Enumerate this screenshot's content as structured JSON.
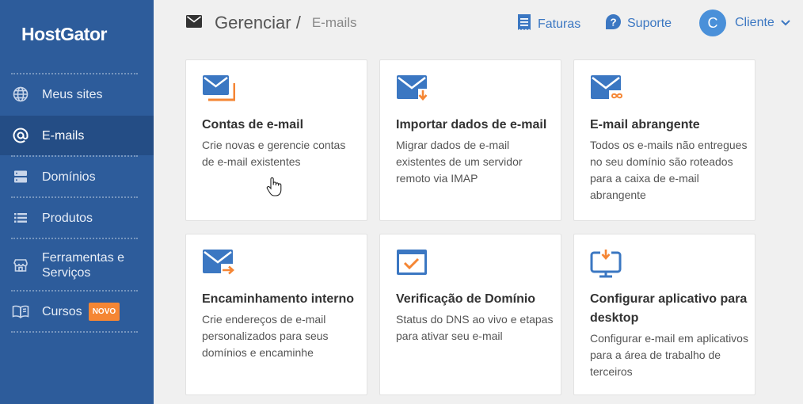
{
  "brand": {
    "logo": "HostGator"
  },
  "sidebar": {
    "items": [
      {
        "label": "Meus sites",
        "icon": "globe-icon"
      },
      {
        "label": "E-mails",
        "icon": "at-icon",
        "active": true
      },
      {
        "label": "Domínios",
        "icon": "server-icon"
      },
      {
        "label": "Produtos",
        "icon": "list-icon"
      },
      {
        "label": "Ferramentas e Serviços",
        "icon": "store-icon"
      },
      {
        "label": "Cursos",
        "icon": "book-icon",
        "badge": "NOVO"
      }
    ]
  },
  "header": {
    "title": "Gerenciar /",
    "subtitle": "E-mails",
    "links": {
      "invoices": "Faturas",
      "support": "Suporte",
      "account": "Cliente",
      "avatar_initial": "C"
    }
  },
  "cards": [
    {
      "title": "Contas de e-mail",
      "desc": "Crie novas e gerencie contas de e-mail existentes",
      "icon": "email-accounts-icon"
    },
    {
      "title": "Importar dados de e-mail",
      "desc": "Migrar dados de e-mail existentes de um servidor remoto via IMAP",
      "icon": "email-import-icon"
    },
    {
      "title": "E-mail abrangente",
      "desc": "Todos os e-mails não entregues no seu domínio são roteados para a caixa de e-mail abrangente",
      "icon": "email-catchall-icon"
    },
    {
      "title": "Encaminhamento interno",
      "desc": "Crie endereços de e-mail personalizados para seus domínios e encaminhe",
      "icon": "email-forward-icon"
    },
    {
      "title": "Verificação de Domínio",
      "desc": "Status do DNS ao vivo e etapas para ativar seu e-mail",
      "icon": "domain-check-icon"
    },
    {
      "title": "Configurar aplicativo para desktop",
      "desc": "Configurar e-mail em aplicativos para a área de trabalho de terceiros",
      "icon": "desktop-app-icon"
    }
  ],
  "colors": {
    "sidebar": "#2d5c9b",
    "accent_blue": "#3b77c2",
    "accent_orange": "#f58634"
  }
}
